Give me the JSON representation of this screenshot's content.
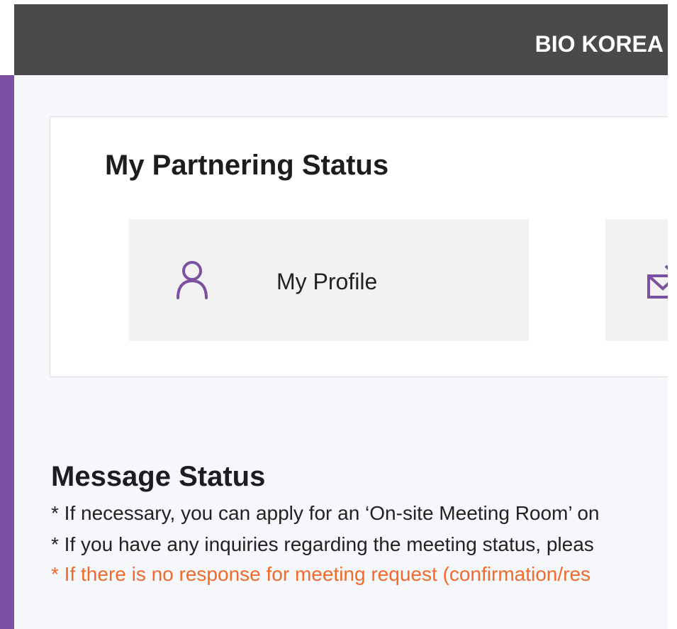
{
  "header": {
    "brand": "BIO KOREA"
  },
  "partnering_status": {
    "title": "My Partnering Status",
    "tiles": [
      {
        "label": "My Profile",
        "icon": "user-icon"
      },
      {
        "label": "",
        "icon": "mail-download-icon"
      }
    ]
  },
  "message_status": {
    "title": "Message Status",
    "lines": [
      "* If necessary, you can apply for an ‘On-site Meeting Room’ on",
      "* If you have any inquiries regarding the meeting status, pleas",
      "* If there is no response for meeting request (confirmation/res"
    ]
  },
  "colors": {
    "topbar": "#4a4a4a",
    "accent": "#7b4fa1",
    "warning_text": "#f26a2a"
  }
}
